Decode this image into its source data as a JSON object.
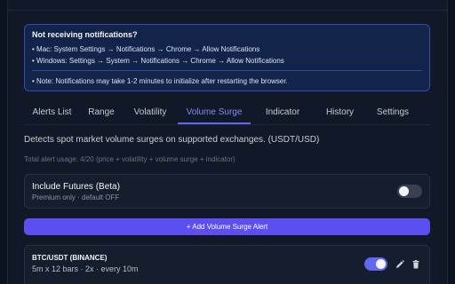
{
  "notice": {
    "title": "Not receiving notifications?",
    "mac": "• Mac: System Settings → Notifications → Chrome → Allow Notifications",
    "windows": "• Windows: Settings → System → Notifications → Chrome → Allow Notifications",
    "note": "• Note: Notifications may take 1-2 minutes to initialize after restarting the browser."
  },
  "tabs": [
    {
      "label": "Alerts List",
      "active": false
    },
    {
      "label": "Range",
      "active": false
    },
    {
      "label": "Volatility",
      "active": false
    },
    {
      "label": "Volume Surge",
      "active": true
    },
    {
      "label": "Indicator",
      "active": false
    },
    {
      "label": "History",
      "active": false
    },
    {
      "label": "Settings",
      "active": false
    }
  ],
  "description": "Detects spot market volume surges on supported exchanges. (USDT/USD)",
  "usage": "Total alert usage: 4/20 (price + volatility + volume surge + indicator)",
  "futures": {
    "title": "Include Futures (Beta)",
    "subtitle": "Premium only · default OFF",
    "enabled": false
  },
  "add_button": "+ Add Volume Surge Alert",
  "alerts": [
    {
      "symbol": "BTC/USDT (BINANCE)",
      "params": "5m x 12 bars · 2x · every 10m",
      "enabled": true
    }
  ],
  "colors": {
    "accent": "#6366f1",
    "background": "#111827",
    "notice_bg": "#13244a",
    "notice_border": "#2f4fb0"
  },
  "icons": {
    "edit": "pencil-icon",
    "delete": "trash-icon"
  }
}
